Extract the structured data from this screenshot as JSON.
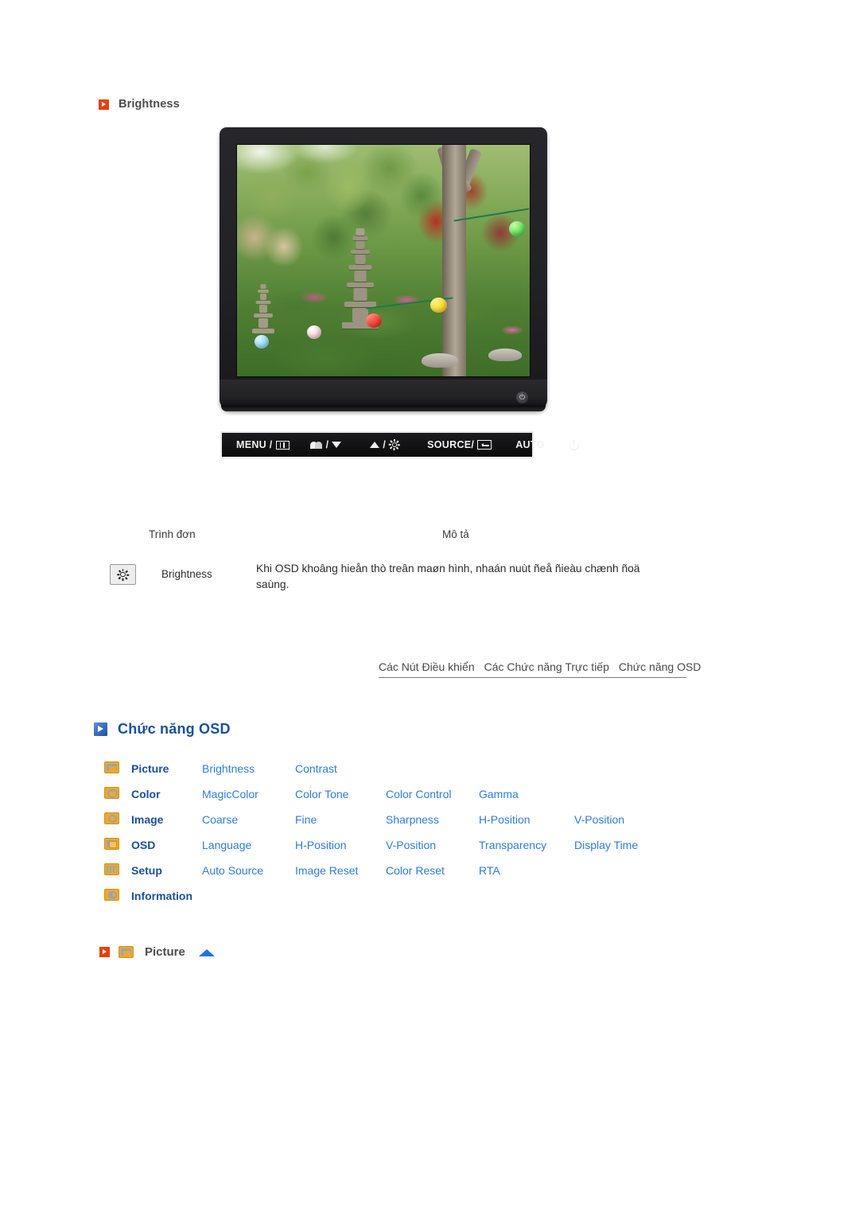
{
  "sections": {
    "brightness": {
      "heading": "Brightness",
      "icon": "red-play-arrow-icon"
    }
  },
  "monitor": {
    "alt": "Samsung LCD monitor front view showing a garden photo with pagodas and paper lanterns",
    "power_led_icon": "power-indicator-icon",
    "buttons": [
      {
        "label": "MENU /",
        "icon": "menu-grid-icon"
      },
      {
        "label": "/",
        "icon_left": "magicbright-icon",
        "icon_right": "triangle-down-icon"
      },
      {
        "label": "/",
        "icon_left": "triangle-up-icon",
        "icon_right": "brightness-sun-icon"
      },
      {
        "label": "SOURCE/",
        "icon": "enter-icon"
      },
      {
        "label": "AUTO",
        "icon": ""
      },
      {
        "label": "",
        "icon": "power-icon"
      }
    ]
  },
  "menu_table": {
    "col_menu": "Trình đơn",
    "col_desc": "Mô tả",
    "rows": [
      {
        "icon": "brightness-sun-icon",
        "label": "Brightness",
        "description": "Khi OSD khoâng hieån thò treân maøn hình, nhaán nuùt ñeå ñieàu chænh ñoä saùng."
      }
    ]
  },
  "nav_links": [
    "Các Nút Điều khiển",
    "Các Chức năng Trực tiếp",
    "Chức năng OSD"
  ],
  "osd_section": {
    "heading": "Chức năng OSD",
    "icon": "blue-play-arrow-icon",
    "rows": [
      {
        "icon": "picture-icon",
        "category": "Picture",
        "items": [
          "Brightness",
          "Contrast",
          "",
          "",
          ""
        ]
      },
      {
        "icon": "color-icon",
        "category": "Color",
        "items": [
          "MagicColor",
          "Color Tone",
          "Color Control",
          "Gamma",
          ""
        ]
      },
      {
        "icon": "image-icon",
        "category": "Image",
        "items": [
          "Coarse",
          "Fine",
          "Sharpness",
          "H-Position",
          "V-Position"
        ]
      },
      {
        "icon": "osd-icon",
        "category": "OSD",
        "items": [
          "Language",
          "H-Position",
          "V-Position",
          "Transparency",
          "Display Time"
        ]
      },
      {
        "icon": "setup-icon",
        "category": "Setup",
        "items": [
          "Auto Source",
          "Image Reset",
          "Color Reset",
          "RTA",
          ""
        ]
      },
      {
        "icon": "information-icon",
        "category": "Information",
        "items": [
          "",
          "",
          "",
          "",
          ""
        ]
      }
    ]
  },
  "picture_subsection": {
    "red_icon": "red-play-arrow-icon",
    "menu_icon": "picture-icon",
    "title": "Picture",
    "back_to_top_icon": "blue-up-arrow-icon"
  },
  "colors": {
    "accent_red": "#e8400c",
    "accent_blue": "#1a4f9c",
    "link_blue": "#2f7bdd",
    "icon_orange": "#f0a82a",
    "text_grey": "#4d4d4d"
  }
}
